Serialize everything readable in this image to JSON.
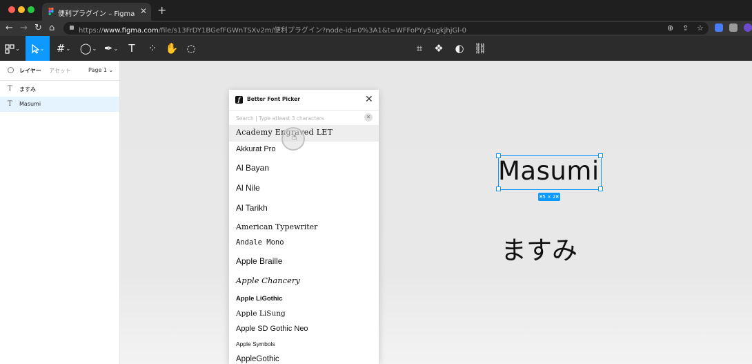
{
  "browser": {
    "tab_title": "便利プラグイン – Figma",
    "tab_close": "✕",
    "new_tab": "+",
    "url_prefix": "https://",
    "url_host": "www.figma.com",
    "url_path": "/file/s13FrDY1BGefFGWnTSXv2m/便利プラグイン?node-id=0%3A1&t=WFFoPYy5ugkjhjGl-0",
    "colors": {
      "red": "#ff5f57",
      "yellow": "#febc2e",
      "green": "#28c840"
    }
  },
  "figma_toolbar": {
    "tools": [
      "main-menu",
      "move",
      "frame",
      "shape",
      "pen",
      "text",
      "resources",
      "hand",
      "comment"
    ],
    "text_tool": "T",
    "accent": "#0d99ff"
  },
  "left_panel": {
    "tab_layers": "レイヤー",
    "tab_assets": "アセット",
    "page": "Page 1 ⌄",
    "layers": [
      {
        "icon": "T",
        "name": "ますみ"
      },
      {
        "icon": "T",
        "name": "Masumi"
      }
    ]
  },
  "canvas": {
    "text_masumi": "Masumi",
    "dimension": "85 × 28",
    "text_jp": "ますみ"
  },
  "plugin": {
    "logo": "f",
    "title": "Better Font Picker",
    "close": "✕",
    "search_placeholder": "Search | Type atleast 3 characters",
    "clear": "✕",
    "fonts": [
      "Academy Engraved LET",
      "Akkurat Pro",
      "Al Bayan",
      "Al Nile",
      "Al Tarikh",
      "American Typewriter",
      "Andale Mono",
      "Apple Braille",
      "Apple Chancery",
      "Apple LiGothic",
      "Apple LiSung",
      "Apple SD Gothic Neo",
      "Apple Symbols",
      "AppleGothic"
    ]
  }
}
